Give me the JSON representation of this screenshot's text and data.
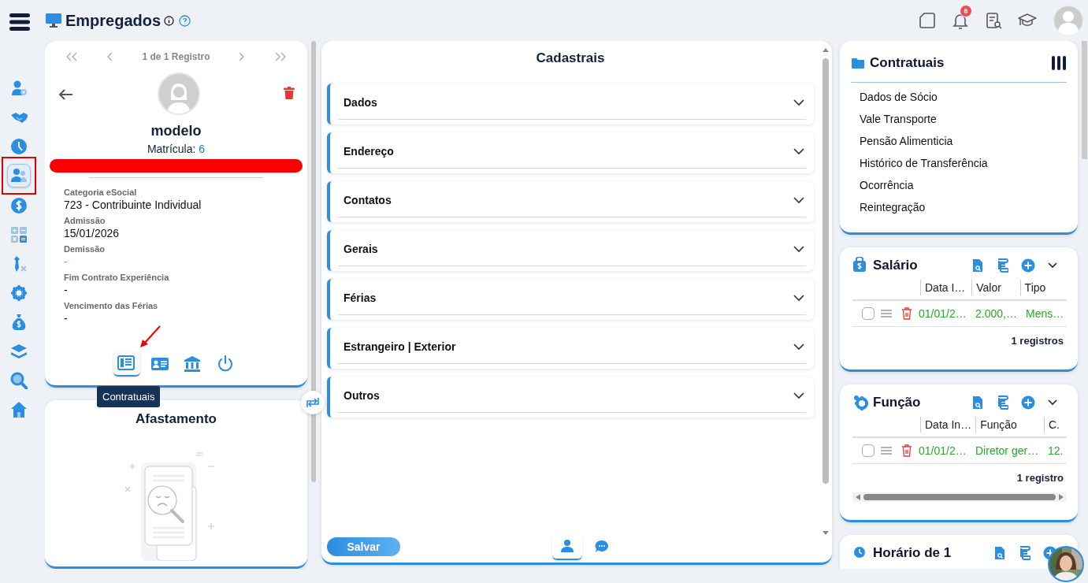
{
  "header": {
    "title": "Empregados",
    "notification_count": "6"
  },
  "sidebar": {
    "items": [
      {
        "selected": false
      },
      {
        "selected": false
      },
      {
        "selected": false
      },
      {
        "selected": true
      },
      {
        "selected": false
      },
      {
        "selected": false
      },
      {
        "selected": false
      },
      {
        "selected": false
      },
      {
        "selected": false
      },
      {
        "selected": false
      },
      {
        "selected": false
      },
      {
        "selected": false
      }
    ]
  },
  "employee_card": {
    "pager": "1 de 1 Registro",
    "name": "modelo",
    "registration_label": "Matrícula:",
    "registration_value": "6",
    "fields": [
      {
        "label": "Categoria eSocial",
        "value": "723 - Contribuinte Individual",
        "kind": "normal"
      },
      {
        "label": "Admissão",
        "value": "15/01/2026",
        "kind": "normal"
      },
      {
        "label": "Demissão",
        "value": "-",
        "kind": "alert"
      },
      {
        "label": "Fim Contrato Experiência",
        "value": "-",
        "kind": "normal"
      },
      {
        "label": "Vencimento das Férias",
        "value": "-",
        "kind": "normal"
      }
    ],
    "actions": [
      {
        "selected": true
      },
      {
        "selected": false
      },
      {
        "selected": false
      },
      {
        "selected": false
      }
    ],
    "tooltip": "Contratuais"
  },
  "absence_card": {
    "title": "Afastamento"
  },
  "registration_panel": {
    "title": "Cadastrais",
    "sections": [
      {
        "label": "Dados",
        "expanded": false
      },
      {
        "label": "Endereço",
        "expanded": false
      },
      {
        "label": "Contatos",
        "expanded": false
      },
      {
        "label": "Gerais",
        "expanded": false
      },
      {
        "label": "Férias",
        "expanded": false
      },
      {
        "label": "Estrangeiro | Exterior",
        "expanded": false
      },
      {
        "label": "Outros",
        "expanded": false
      }
    ],
    "save_button": "Salvar",
    "footer_tabs": [
      {
        "selected": true
      },
      {
        "selected": false
      }
    ]
  },
  "contract_panel": {
    "title": "Contratuais",
    "items": [
      "Dados de Sócio",
      "Vale Transporte",
      "Pensão Alimenticia",
      "Histórico de Transferência",
      "Ocorrência",
      "Reintegração"
    ]
  },
  "tables": [
    {
      "title": "Salário",
      "columns": [
        "Data I…",
        "Valor",
        "Tipo"
      ],
      "rows": [
        {
          "checked": false,
          "cells": [
            "01/01/2…",
            "2.000,…",
            "Mens…"
          ]
        }
      ],
      "footer": "1 registros",
      "scrollbar": false
    },
    {
      "title": "Função",
      "columns": [
        "Data In…",
        "Função",
        "C."
      ],
      "rows": [
        {
          "checked": false,
          "cells": [
            "01/01/2…",
            "Diretor ger…",
            "12."
          ]
        }
      ],
      "footer": "1 registro",
      "scrollbar": true
    },
    {
      "title": "Horário de 1"
    }
  ]
}
